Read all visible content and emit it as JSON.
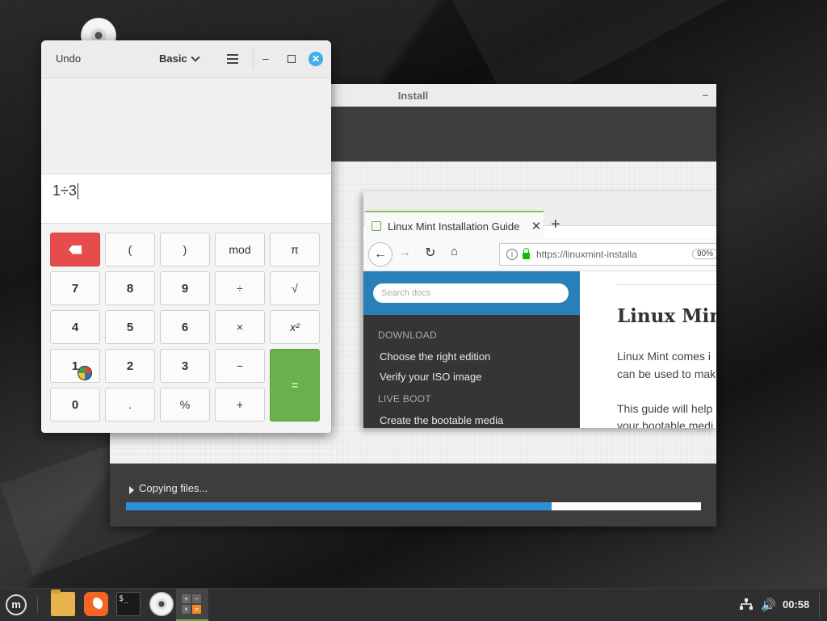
{
  "calculator": {
    "undo_label": "Undo",
    "mode_label": "Basic",
    "menu_icon": "hamburger-icon",
    "expression": "1÷3",
    "keys": {
      "delete": "⌫",
      "open_paren": "(",
      "close_paren": ")",
      "mod": "mod",
      "pi": "π",
      "seven": "7",
      "eight": "8",
      "nine": "9",
      "divide": "÷",
      "sqrt": "√",
      "four": "4",
      "five": "5",
      "six": "6",
      "multiply": "×",
      "square": "x²",
      "one": "1",
      "two": "2",
      "three": "3",
      "minus": "−",
      "equals": "=",
      "zero": "0",
      "decimal": ".",
      "percent": "%",
      "plus": "+"
    }
  },
  "installer": {
    "title": "Install",
    "status": "Copying files...",
    "progress_fraction": 0.74
  },
  "browser": {
    "tab_title": "Linux Mint Installation Guide",
    "url": "https://linuxmint-installa",
    "zoom": "90%",
    "search_placeholder": "Search docs",
    "sidebar": {
      "section_download": "DOWNLOAD",
      "item_choose": "Choose the right edition",
      "item_verify": "Verify your ISO image",
      "section_liveboot": "LIVE BOOT",
      "item_create": "Create the bootable media"
    },
    "doc": {
      "title": "Linux Min",
      "para1_line1": "Linux Mint comes i",
      "para1_line2": "can be used to mak",
      "para2_line1": "This guide will help",
      "para2_line2": "your bootable medi"
    }
  },
  "taskbar": {
    "menu_icon": "mint-menu-icon",
    "menu_glyph": "m",
    "terminal_glyph": "$_",
    "clock": "00:58"
  },
  "colors": {
    "accent_blue": "#2d8fd5",
    "delete_red": "#e74c4c",
    "equals_green": "#6ab04c",
    "sidebar_blue": "#2980b9"
  }
}
